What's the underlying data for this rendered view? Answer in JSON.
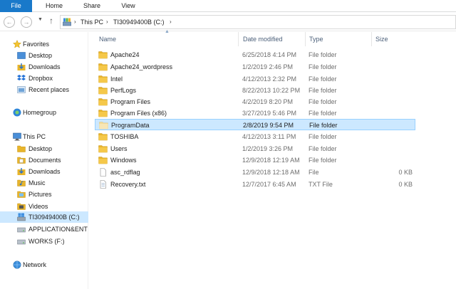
{
  "ribbon": {
    "tabs": [
      {
        "label": "File",
        "active": true
      },
      {
        "label": "Home"
      },
      {
        "label": "Share"
      },
      {
        "label": "View"
      }
    ]
  },
  "address": {
    "back_icon": "back-arrow-icon",
    "forward_icon": "forward-arrow-icon",
    "up_icon": "up-arrow-icon",
    "crumbs": [
      "This PC",
      "TI30949400B (C:)"
    ]
  },
  "sidebar": {
    "favorites": {
      "label": "Favorites",
      "items": [
        "Desktop",
        "Downloads",
        "Dropbox",
        "Recent places"
      ]
    },
    "homegroup": {
      "label": "Homegroup"
    },
    "this_pc": {
      "label": "This PC",
      "items": [
        "Desktop",
        "Documents",
        "Downloads",
        "Music",
        "Pictures",
        "Videos"
      ],
      "drives": [
        "TI30949400B (C:)",
        "APPLICATION&ENT",
        "WORKS (F:)"
      ]
    },
    "network": {
      "label": "Network"
    }
  },
  "columns": {
    "name": "Name",
    "date": "Date modified",
    "type": "Type",
    "size": "Size"
  },
  "files": [
    {
      "name": "Apache24",
      "date": "6/25/2018 4:14 PM",
      "type": "File folder",
      "size": "",
      "kind": "folder"
    },
    {
      "name": "Apache24_wordpress",
      "date": "1/2/2019 2:46 PM",
      "type": "File folder",
      "size": "",
      "kind": "folder"
    },
    {
      "name": "Intel",
      "date": "4/12/2013 2:32 PM",
      "type": "File folder",
      "size": "",
      "kind": "folder"
    },
    {
      "name": "PerfLogs",
      "date": "8/22/2013 10:22 PM",
      "type": "File folder",
      "size": "",
      "kind": "folder"
    },
    {
      "name": "Program Files",
      "date": "4/2/2019 8:20 PM",
      "type": "File folder",
      "size": "",
      "kind": "folder"
    },
    {
      "name": "Program Files (x86)",
      "date": "3/27/2019 5:46 PM",
      "type": "File folder",
      "size": "",
      "kind": "folder"
    },
    {
      "name": "ProgramData",
      "date": "2/8/2019 9:54 PM",
      "type": "File folder",
      "size": "",
      "kind": "folder-faded",
      "selected": true
    },
    {
      "name": "TOSHIBA",
      "date": "4/12/2013 3:11 PM",
      "type": "File folder",
      "size": "",
      "kind": "folder"
    },
    {
      "name": "Users",
      "date": "1/2/2019 3:26 PM",
      "type": "File folder",
      "size": "",
      "kind": "folder"
    },
    {
      "name": "Windows",
      "date": "12/9/2018 12:19 AM",
      "type": "File folder",
      "size": "",
      "kind": "folder"
    },
    {
      "name": "asc_rdflag",
      "date": "12/9/2018 12:18 AM",
      "type": "File",
      "size": "0 KB",
      "kind": "file"
    },
    {
      "name": "Recovery.txt",
      "date": "12/7/2017 6:45 AM",
      "type": "TXT File",
      "size": "0 KB",
      "kind": "txt"
    }
  ],
  "colors": {
    "file_tab": "#1979ca",
    "selection_bg": "#cce8ff",
    "selection_border": "#99d1ff",
    "folder_yellow": "#e8b52b"
  }
}
